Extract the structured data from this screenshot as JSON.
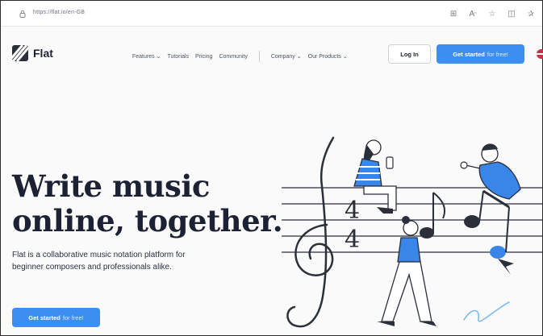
{
  "browser": {
    "url": "https://flat.io/en-GB",
    "icons": [
      "grid-icon",
      "read-aloud-icon",
      "star-icon",
      "split-screen-icon",
      "favorites-icon"
    ]
  },
  "header": {
    "brand": "Flat",
    "nav": [
      {
        "label": "Features ⌄"
      },
      {
        "label": "Tutorials"
      },
      {
        "label": "Pricing"
      },
      {
        "label": "Community"
      }
    ],
    "nav_right": [
      {
        "label": "Company ⌄"
      },
      {
        "label": "Our Products ⌄"
      }
    ],
    "login_label": "Log In",
    "cta_strong": "Get started",
    "cta_light": "for free!"
  },
  "hero": {
    "title_line1": "Write music",
    "title_line2": "online, together.",
    "subtitle": "Flat is a collaborative music notation platform for beginner composers and professionals alike.",
    "cta_strong": "Get started",
    "cta_light": "for free!"
  },
  "colors": {
    "accent": "#3c8ff0",
    "text": "#1c2233",
    "illustration_blue": "#3a86e8"
  }
}
